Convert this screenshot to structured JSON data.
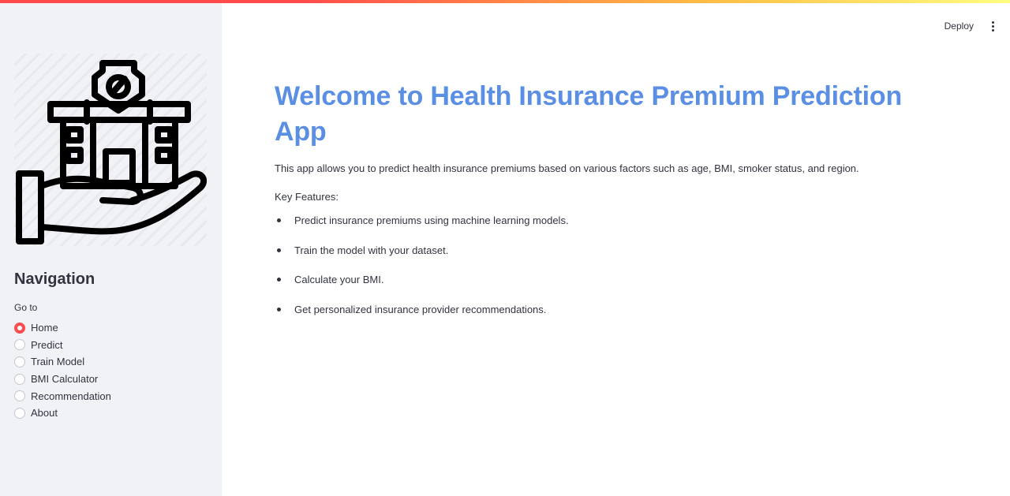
{
  "header": {
    "deploy_label": "Deploy",
    "menu_icon": "more-vertical-icon"
  },
  "sidebar": {
    "logo_icon": "hand-holding-building-shield-icon",
    "nav_title": "Navigation",
    "radio_caption": "Go to",
    "selected": "Home",
    "options": [
      {
        "label": "Home",
        "checked": true
      },
      {
        "label": "Predict",
        "checked": false
      },
      {
        "label": "Train Model",
        "checked": false
      },
      {
        "label": "BMI Calculator",
        "checked": false
      },
      {
        "label": "Recommendation",
        "checked": false
      },
      {
        "label": "About",
        "checked": false
      }
    ],
    "accent_color": "#ff4b4b"
  },
  "main": {
    "title": "Welcome to Health Insurance Premium Prediction App",
    "title_color": "#5b8fe4",
    "intro": "This app allows you to predict health insurance premiums based on various factors such as age, BMI, smoker status, and region.",
    "features_label": "Key Features:",
    "features": [
      "Predict insurance premiums using machine learning models.",
      "Train the model with your dataset.",
      "Calculate your BMI.",
      "Get personalized insurance provider recommendations."
    ]
  }
}
